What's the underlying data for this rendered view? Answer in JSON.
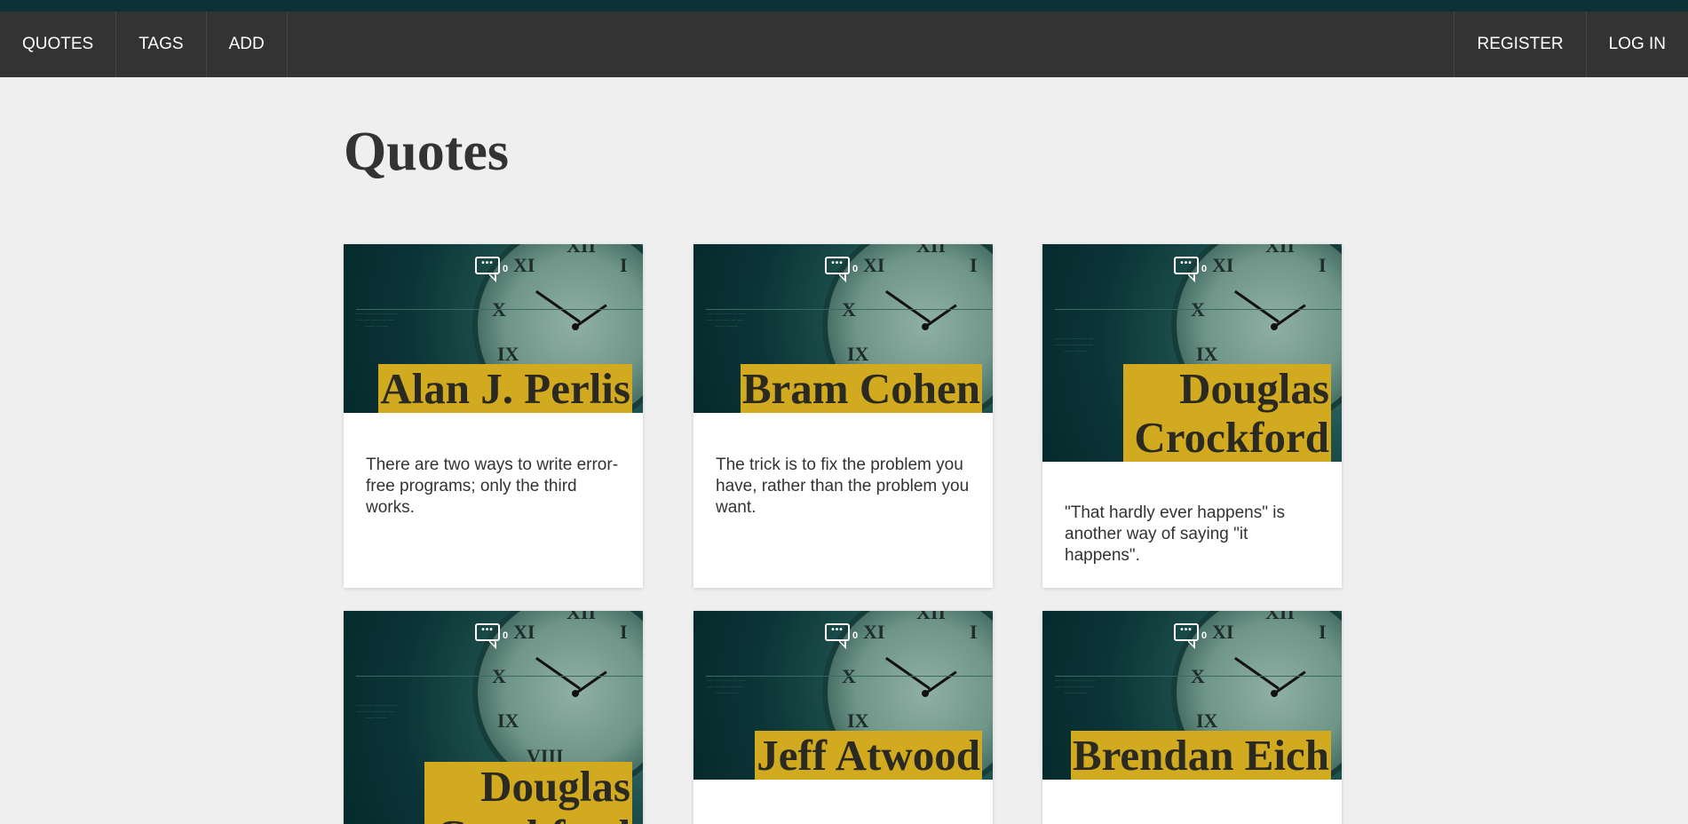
{
  "nav": {
    "left": [
      "QUOTES",
      "TAGS",
      "ADD"
    ],
    "right": [
      "REGISTER",
      "LOG IN"
    ]
  },
  "page_title": "Quotes",
  "cards": [
    {
      "author": "Alan J. Perlis",
      "quote": "There are two ways to write error-free programs; only the third works.",
      "comments": "0"
    },
    {
      "author": "Bram Cohen",
      "quote": "The trick is to fix the problem you have, rather than the problem you want.",
      "comments": "0"
    },
    {
      "author": "Douglas Crockford",
      "quote": "\"That hardly ever happens\" is another way of saying \"it happens\".",
      "comments": "0"
    },
    {
      "author": "Douglas Crockford",
      "quote": "",
      "comments": "0"
    },
    {
      "author": "Jeff Atwood",
      "quote": "",
      "comments": "0"
    },
    {
      "author": "Brendan Eich",
      "quote": "",
      "comments": "0"
    }
  ],
  "icons": {
    "comment": "comment-bubble-icon"
  },
  "colors": {
    "highlight": "#d2aa1f",
    "navbar": "#333333",
    "card_bg": "#0b3436"
  }
}
